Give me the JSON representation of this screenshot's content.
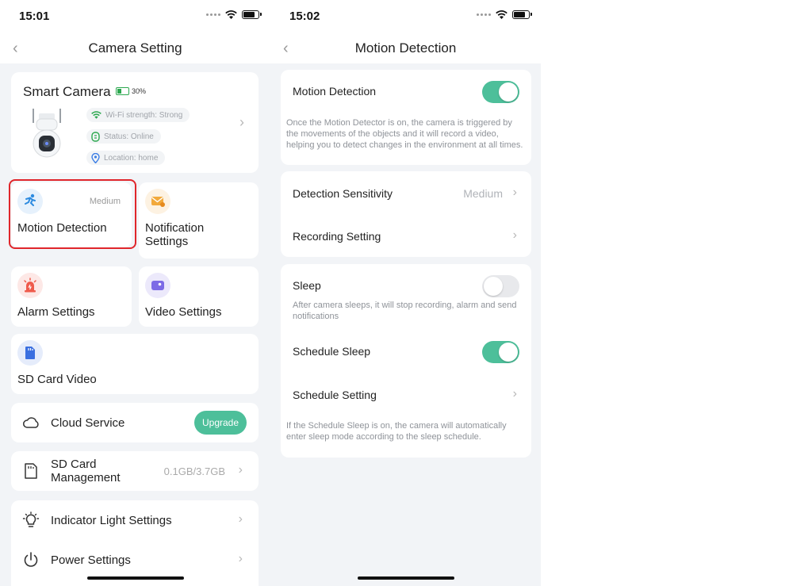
{
  "left": {
    "status": {
      "time": "15:01"
    },
    "nav": {
      "back": "‹",
      "title": "Camera Setting"
    },
    "device": {
      "name": "Smart Camera",
      "battery": "30%",
      "wifi": "Wi-Fi strength: Strong",
      "status": "Status: Online",
      "location": "Location: home"
    },
    "tiles": {
      "motion": {
        "label": "Motion Detection",
        "value": "Medium"
      },
      "notification": {
        "label": "Notification Settings"
      },
      "alarm": {
        "label": "Alarm Settings"
      },
      "video": {
        "label": "Video Settings"
      },
      "sdvideo": {
        "label": "SD Card Video"
      }
    },
    "cloud": {
      "label": "Cloud Service",
      "button": "Upgrade"
    },
    "sd_management": {
      "label": "SD Card Management",
      "value": "0.1GB/3.7GB"
    },
    "indicator": {
      "label": "Indicator Light Settings"
    },
    "power": {
      "label": "Power Settings"
    }
  },
  "right": {
    "status": {
      "time": "15:02"
    },
    "nav": {
      "back": "‹",
      "title": "Motion Detection"
    },
    "motion": {
      "label": "Motion Detection",
      "enabled": true,
      "description": "Once the Motion Detector is on, the camera is triggered by the movements of the objects and it will record a video, helping you to detect changes in the environment at all times."
    },
    "sensitivity": {
      "label": "Detection Sensitivity",
      "value": "Medium"
    },
    "recording": {
      "label": "Recording Setting"
    },
    "sleep": {
      "label": "Sleep",
      "enabled": false,
      "description": "After camera sleeps, it will stop recording, alarm and send notifications"
    },
    "schedule_sleep": {
      "label": "Schedule Sleep",
      "enabled": true
    },
    "schedule_setting": {
      "label": "Schedule Setting"
    },
    "schedule_description": "If the Schedule Sleep is on, the camera will automatically enter sleep mode according to the sleep schedule."
  },
  "colors": {
    "accent": "#4dbf9a",
    "highlight": "#e0262b",
    "background": "#f2f4f7"
  }
}
